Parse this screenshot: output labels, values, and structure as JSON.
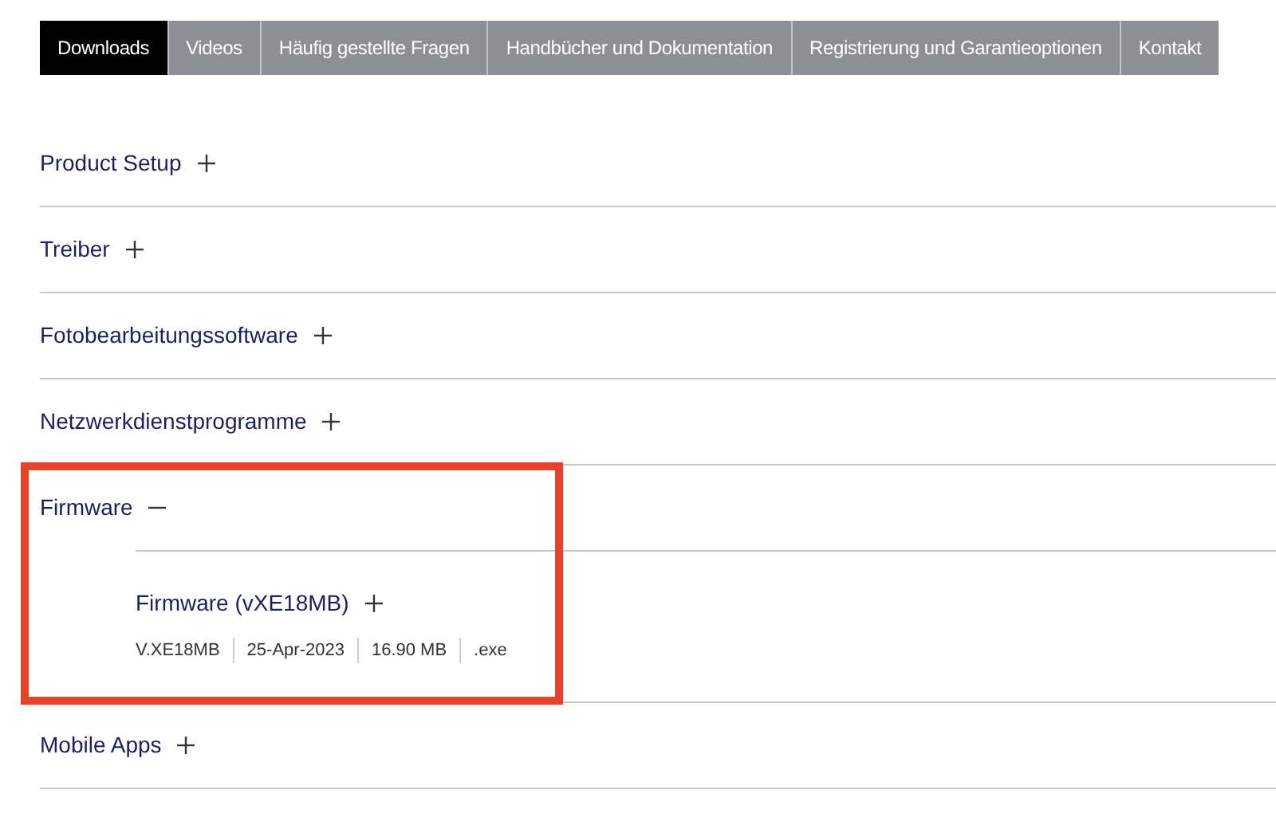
{
  "tabs": [
    {
      "label": "Downloads",
      "selected": true
    },
    {
      "label": "Videos",
      "selected": false
    },
    {
      "label": "Häufig gestellte Fragen",
      "selected": false
    },
    {
      "label": "Handbücher und Dokumentation",
      "selected": false
    },
    {
      "label": "Registrierung und Garantieoptionen",
      "selected": false
    },
    {
      "label": "Kontakt",
      "selected": false
    }
  ],
  "sections": [
    {
      "title": "Product Setup",
      "expanded": false
    },
    {
      "title": "Treiber",
      "expanded": false
    },
    {
      "title": "Fotobearbeitungssoftware",
      "expanded": false
    },
    {
      "title": "Netzwerkdienstprogramme",
      "expanded": false
    },
    {
      "title": "Firmware",
      "expanded": true,
      "highlighted": true,
      "children": [
        {
          "title": "Firmware (vXE18MB)",
          "expanded": false,
          "details": [
            "V.XE18MB",
            "25-Apr-2023",
            "16.90 MB",
            ".exe"
          ]
        }
      ]
    },
    {
      "title": "Mobile Apps",
      "expanded": false
    }
  ]
}
